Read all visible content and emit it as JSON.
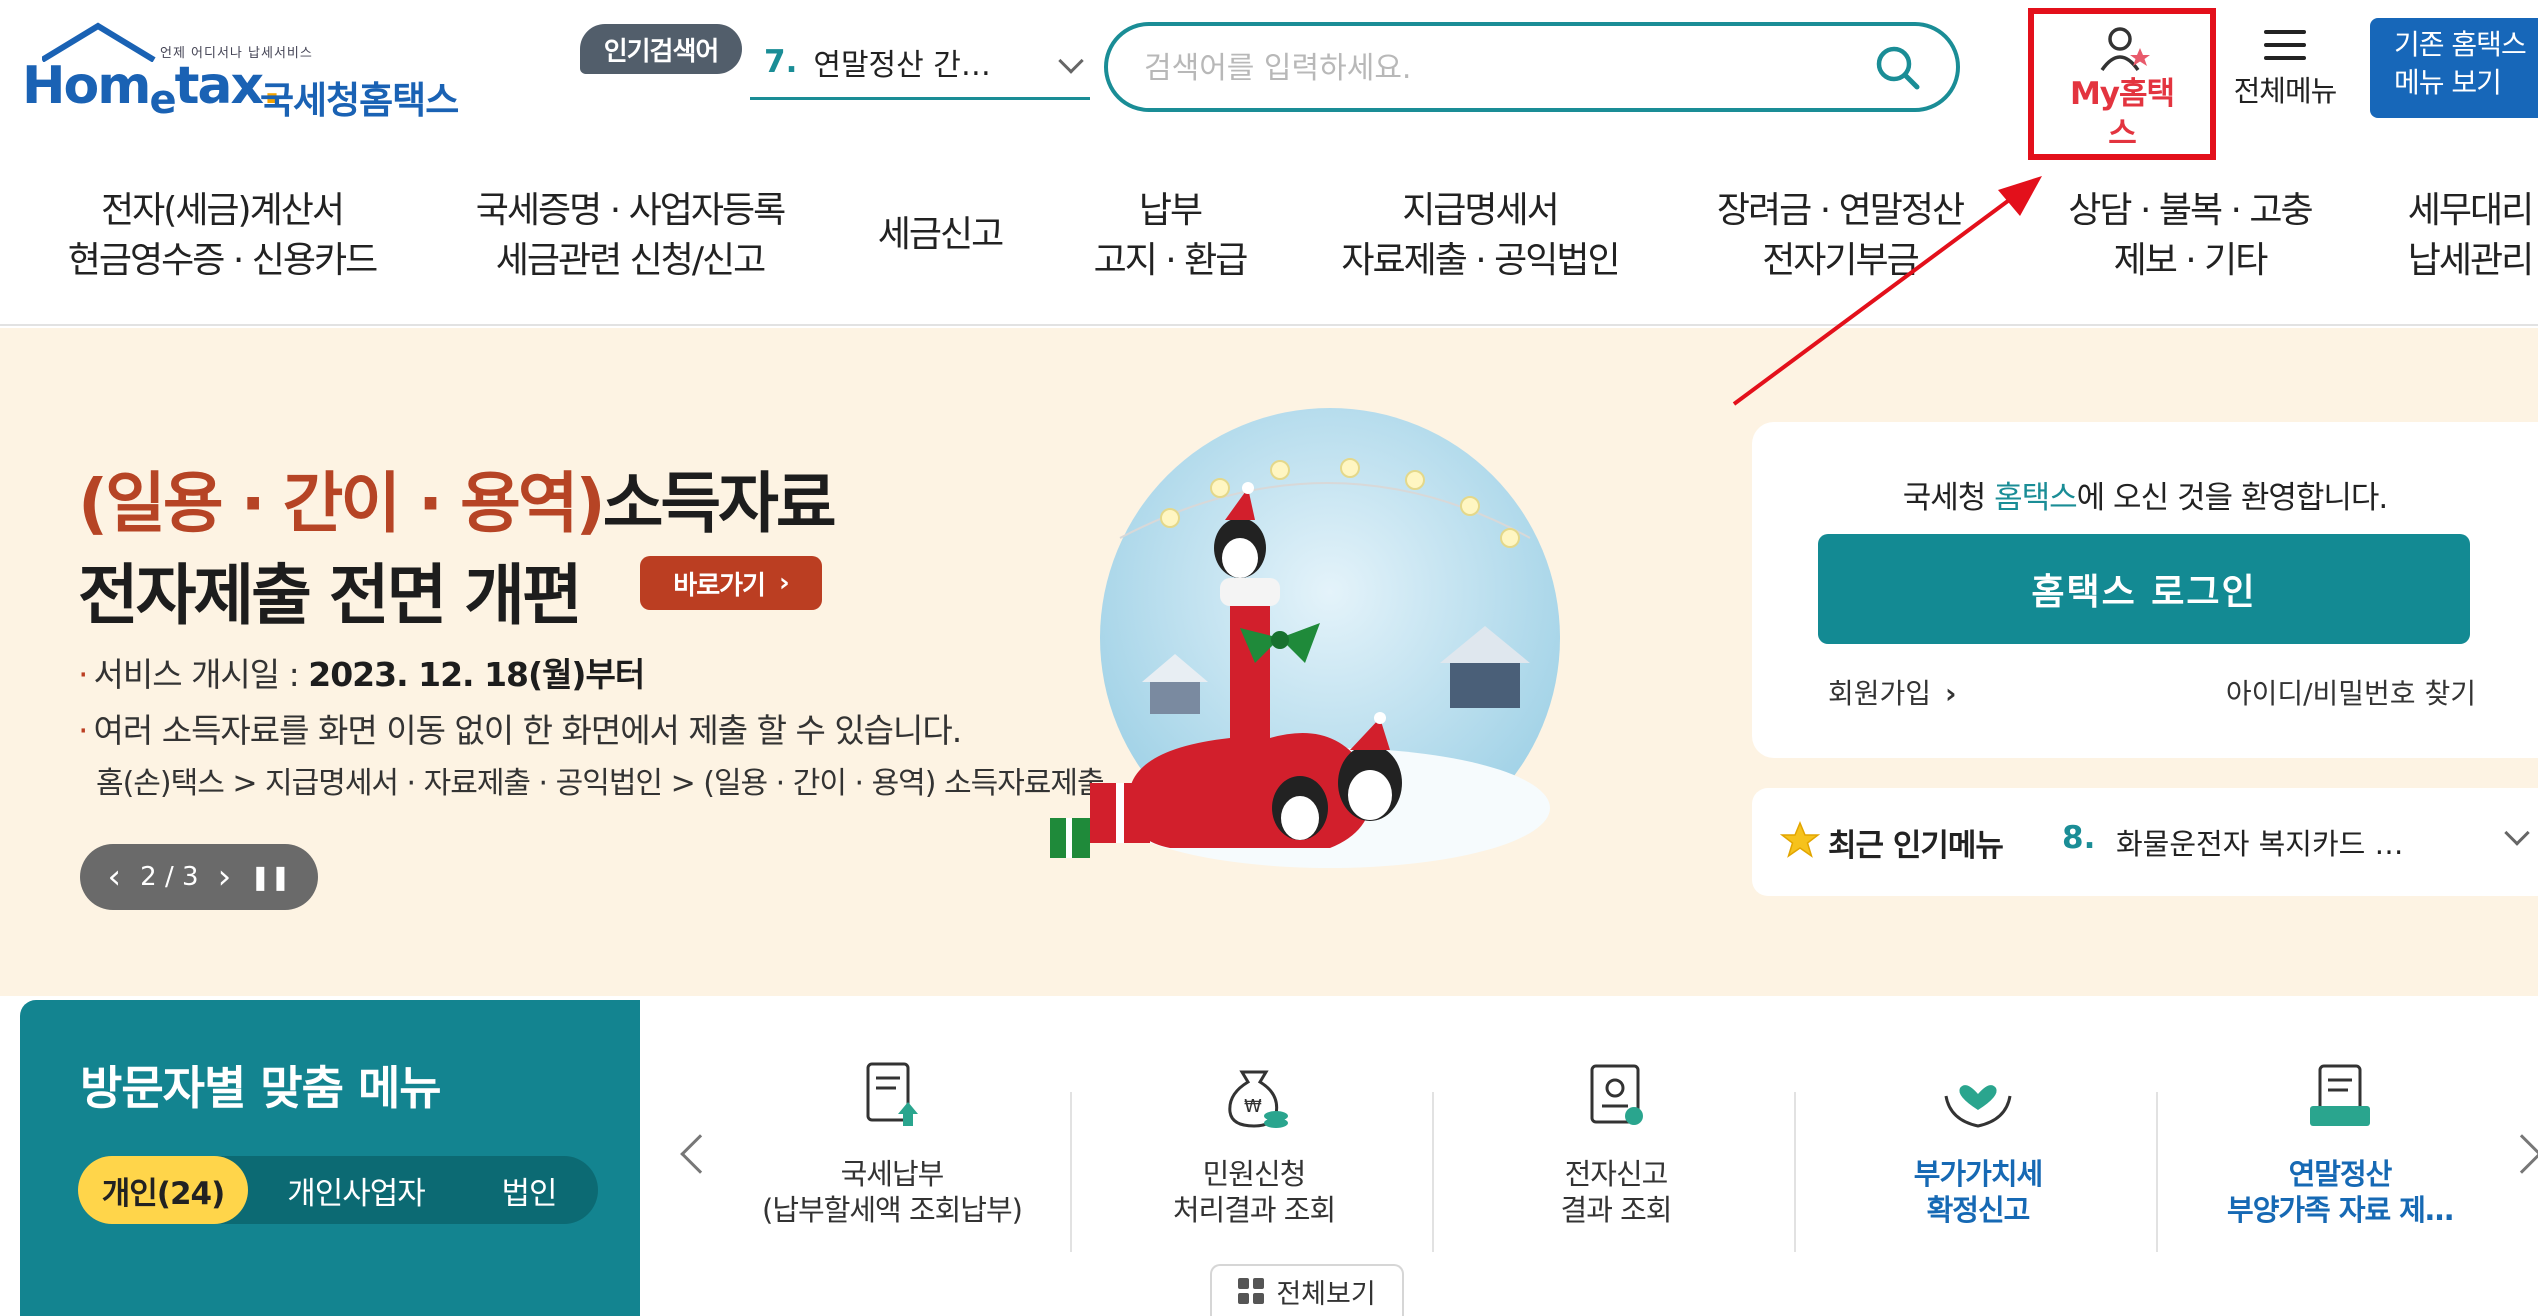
{
  "header": {
    "logo_tagline": "언제 어디서나 납세서비스",
    "logo_brand_a": "Hom",
    "logo_brand_e": "e",
    "logo_brand_b": "tax",
    "logo_dot": ".",
    "logo_kor": "국세청홈택스",
    "popular_badge": "인기검색어",
    "popular_rank": "7.",
    "popular_term": "연말정산 간…",
    "search_placeholder": "검색어를 입력하세요.",
    "my_hometax_line1": "My홈택",
    "my_hometax_line2": "스",
    "all_menu_label": "전체메뉴",
    "old_menu_line1": "기존 홈택스",
    "old_menu_line2": "메뉴 보기"
  },
  "gnb": [
    {
      "l1": "전자(세금)계산서",
      "l2": "현금영수증 · 신용카드"
    },
    {
      "l1": "국세증명 · 사업자등록",
      "l2": "세금관련 신청/신고"
    },
    {
      "l1": "세금신고",
      "l2": ""
    },
    {
      "l1": "납부",
      "l2": "고지 · 환급"
    },
    {
      "l1": "지급명세서",
      "l2": "자료제출 · 공익법인"
    },
    {
      "l1": "장려금 · 연말정산",
      "l2": "전자기부금"
    },
    {
      "l1": "상담 · 불복 · 고충",
      "l2": "제보 · 기타"
    },
    {
      "l1": "세무대리",
      "l2": "납세관리"
    }
  ],
  "banner": {
    "title_hl": "(일용 · 간이 · 용역)",
    "title_rest": "소득자료",
    "title2": "전자제출 전면 개편",
    "go_button": "바로가기",
    "item1_label": "서비스 개시일 : ",
    "item1_value": "2023. 12. 18(월)부터",
    "item2": "여러 소득자료를 화면 이동 없이 한 화면에서 제출 할 수 있습니다.",
    "path": "홈(손)택스 > 지급명세서 · 자료제출 · 공익법인 > (일용 · 간이 · 용역) 소득자료제출",
    "slide_indicator": "2 / 3"
  },
  "login": {
    "welcome_prefix": "국세청 ",
    "welcome_brand": "홈택스",
    "welcome_suffix": "에 오신 것을 환영합니다.",
    "login_button": "홈택스 로그인",
    "join": "회원가입",
    "find": "아이디/비밀번호 찾기"
  },
  "recent": {
    "label": "최근 인기메뉴",
    "rank": "8.",
    "term": "화물운전자 복지카드 …"
  },
  "visitor": {
    "title": "방문자별 맞춤 메뉴",
    "tabs": [
      "개인(24)",
      "개인사업자",
      "법인"
    ],
    "active_tab": 0
  },
  "quick": [
    {
      "l1": "국세납부",
      "l2": "(납부할세액 조회납부)",
      "icon": "tax-payment-icon",
      "highlight": false
    },
    {
      "l1": "민원신청",
      "l2": "처리결과 조회",
      "icon": "money-bag-icon",
      "highlight": false
    },
    {
      "l1": "전자신고",
      "l2": "결과 조회",
      "icon": "certificate-icon",
      "highlight": false
    },
    {
      "l1": "부가가치세",
      "l2": "확정신고",
      "icon": "heart-hands-icon",
      "highlight": true
    },
    {
      "l1": "연말정산",
      "l2": "부양가족 자료 제…",
      "icon": "document-tray-icon",
      "highlight": true
    }
  ],
  "view_all": "전체보기",
  "colors": {
    "brand_blue": "#1a62b4",
    "teal": "#138a93",
    "banner_bg": "#fdf3e3",
    "annotation_red": "#e3101b",
    "active_tab": "#ffd54a"
  }
}
